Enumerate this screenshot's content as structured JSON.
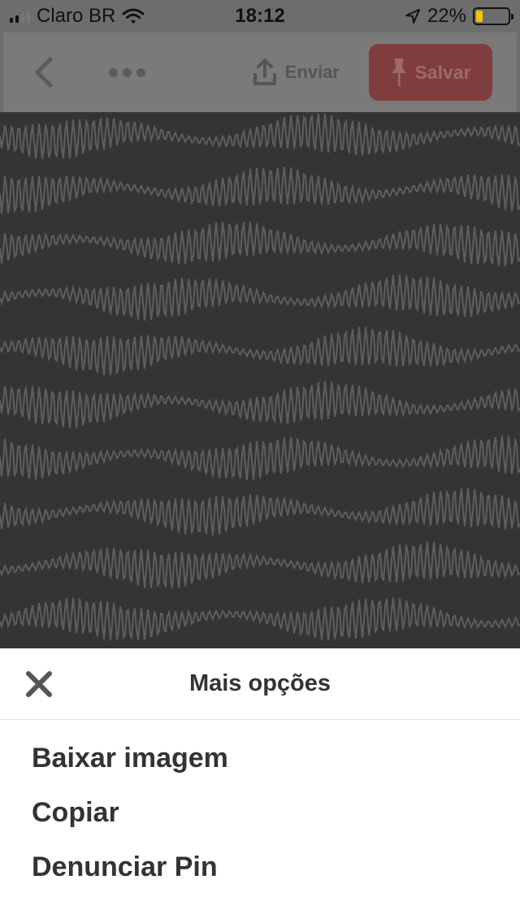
{
  "status_bar": {
    "carrier": "Claro BR",
    "time": "18:12",
    "battery_percent": "22%",
    "battery_level": 0.22,
    "icons": [
      "signal-icon",
      "wifi-icon",
      "location-arrow-icon",
      "battery-icon"
    ]
  },
  "nav": {
    "back_icon": "chevron-left-icon",
    "more_icon": "ellipsis-icon",
    "send_label": "Enviar",
    "send_icon": "share-upload-icon",
    "save_label": "Salvar",
    "save_icon": "pin-icon"
  },
  "colors": {
    "save_button": "#803d3d",
    "sheet_background": "#ffffff",
    "text": "#333333"
  },
  "sheet": {
    "title": "Mais opções",
    "close_icon": "close-x-icon",
    "items": [
      {
        "label": "Baixar imagem"
      },
      {
        "label": "Copiar"
      },
      {
        "label": "Denunciar Pin"
      }
    ]
  }
}
